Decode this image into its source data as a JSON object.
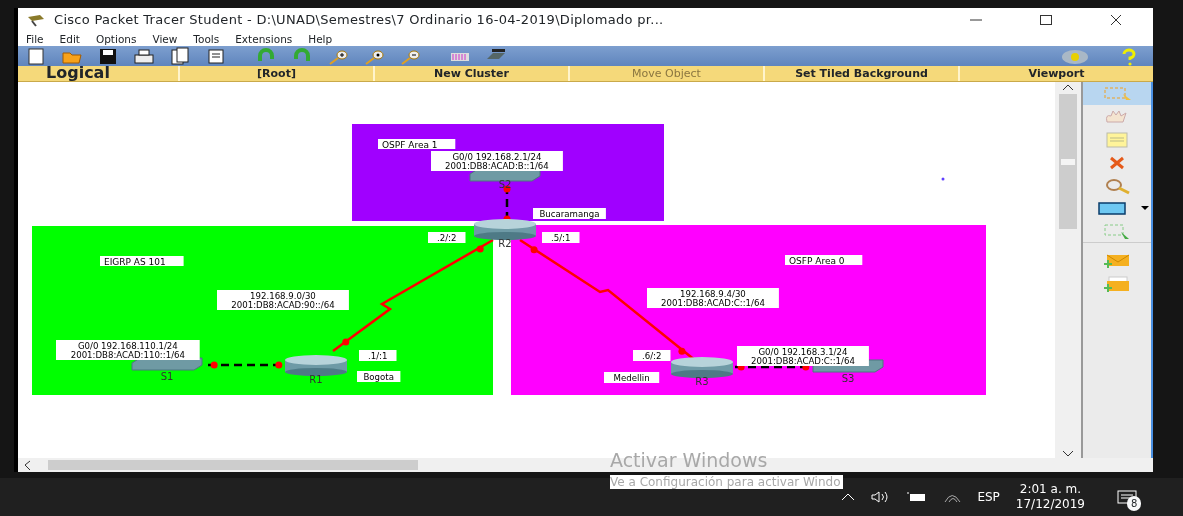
{
  "window": {
    "title": "Cisco Packet Tracer Student - D:\\UNAD\\Semestres\\7 Ordinario 16-04-2019\\Diplomado pr..."
  },
  "menu": [
    "File",
    "Edit",
    "Options",
    "View",
    "Tools",
    "Extensions",
    "Help"
  ],
  "workspace_bar": {
    "mode": "Logical",
    "items": [
      {
        "label": "[Root]",
        "disabled": false
      },
      {
        "label": "New Cluster",
        "disabled": false
      },
      {
        "label": "Move Object",
        "disabled": true
      },
      {
        "label": "Set Tiled Background",
        "disabled": false
      },
      {
        "label": "Viewport",
        "disabled": false
      }
    ]
  },
  "areas": [
    {
      "label": "OSPF Area 1",
      "color": "#a000ff"
    },
    {
      "label": "EIGRP AS 101",
      "color": "#00ff00"
    },
    {
      "label": "OSFP Area 0",
      "color": "#ff00ff"
    }
  ],
  "links": [
    {
      "kind": "serial"
    },
    {
      "kind": "serial"
    },
    {
      "kind": "ethernet"
    },
    {
      "kind": "ethernet"
    },
    {
      "kind": "ethernet"
    }
  ],
  "devices": [
    {
      "name": "S2",
      "kind": "switch"
    },
    {
      "name": "R2",
      "kind": "router"
    },
    {
      "name": "S1",
      "kind": "switch"
    },
    {
      "name": "R1",
      "kind": "router"
    },
    {
      "name": "R3",
      "kind": "router"
    },
    {
      "name": "S3",
      "kind": "switch"
    }
  ],
  "notes": [
    {
      "lines": [
        "G0/0 192.168.2.1/24",
        "2001:DB8:ACAD:B::1/64"
      ]
    },
    {
      "lines": [
        "Bucaramanga"
      ]
    },
    {
      "lines": [
        ".2/:2"
      ]
    },
    {
      "lines": [
        ".5/:1"
      ]
    },
    {
      "lines": [
        "192.168.9.0/30",
        "2001:DB8:ACAD:90::/64"
      ]
    },
    {
      "lines": [
        "G0/0 192.168.110.1/24",
        "2001:DB8:ACAD:110::1/64"
      ]
    },
    {
      "lines": [
        ".1/:1"
      ]
    },
    {
      "lines": [
        "Bogota"
      ]
    },
    {
      "lines": [
        "192.168.9.4/30",
        "2001:DB8:ACAD:C::1/64"
      ]
    },
    {
      "lines": [
        ".6/:2"
      ]
    },
    {
      "lines": [
        "Medellin"
      ]
    },
    {
      "lines": [
        "G0/0 192.168.3.1/24",
        "2001:DB8:ACAD:C::1/64"
      ]
    }
  ],
  "palette": [
    {
      "kind": "select",
      "selected": true
    },
    {
      "kind": "hand",
      "selected": false
    },
    {
      "kind": "note",
      "selected": false
    },
    {
      "kind": "delete",
      "selected": false
    },
    {
      "kind": "inspect",
      "selected": false
    },
    {
      "kind": "shape",
      "selected": false
    },
    {
      "kind": "resize",
      "selected": false
    },
    {
      "kind": "simple-pdu",
      "selected": false
    },
    {
      "kind": "complex-pdu",
      "selected": false
    }
  ],
  "activation": {
    "title": "Activar Windows",
    "subtitle": "Ve a Configuración para activar Windo"
  },
  "taskbar": {
    "language": "ESP",
    "time": "2:01 a. m.",
    "date": "17/12/2019",
    "notifications": "8"
  }
}
